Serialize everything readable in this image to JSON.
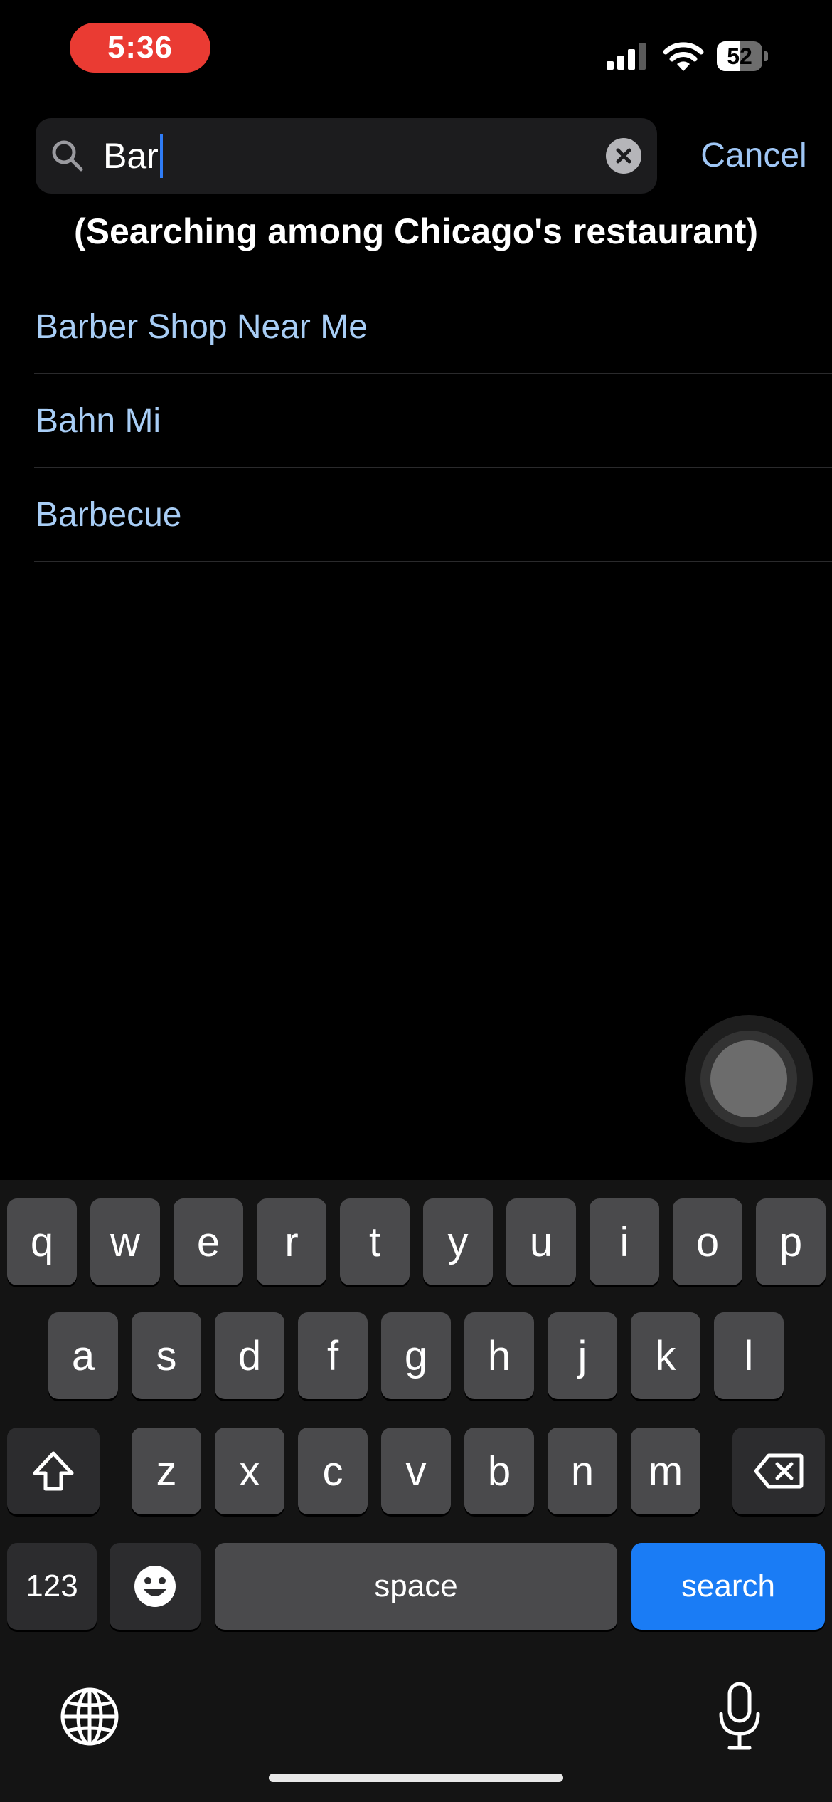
{
  "status_bar": {
    "time": "5:36",
    "battery_level": "52",
    "signal": "signal-icon",
    "wifi": "wifi-icon"
  },
  "search": {
    "value": "Bar",
    "cancel_label": "Cancel",
    "caption": "(Searching among Chicago's restaurant)"
  },
  "suggestions": [
    {
      "label": "Barber Shop Near Me"
    },
    {
      "label": "Bahn Mi"
    },
    {
      "label": "Barbecue"
    }
  ],
  "keyboard": {
    "row1": [
      "q",
      "w",
      "e",
      "r",
      "t",
      "y",
      "u",
      "i",
      "o",
      "p"
    ],
    "row2": [
      "a",
      "s",
      "d",
      "f",
      "g",
      "h",
      "j",
      "k",
      "l"
    ],
    "row3": [
      "z",
      "x",
      "c",
      "v",
      "b",
      "n",
      "m"
    ],
    "numbers_label": "123",
    "space_label": "space",
    "search_label": "search"
  },
  "colors": {
    "accent": "#1a7cf5",
    "link": "#a8cdf5",
    "time_pill": "#ea3b33"
  }
}
